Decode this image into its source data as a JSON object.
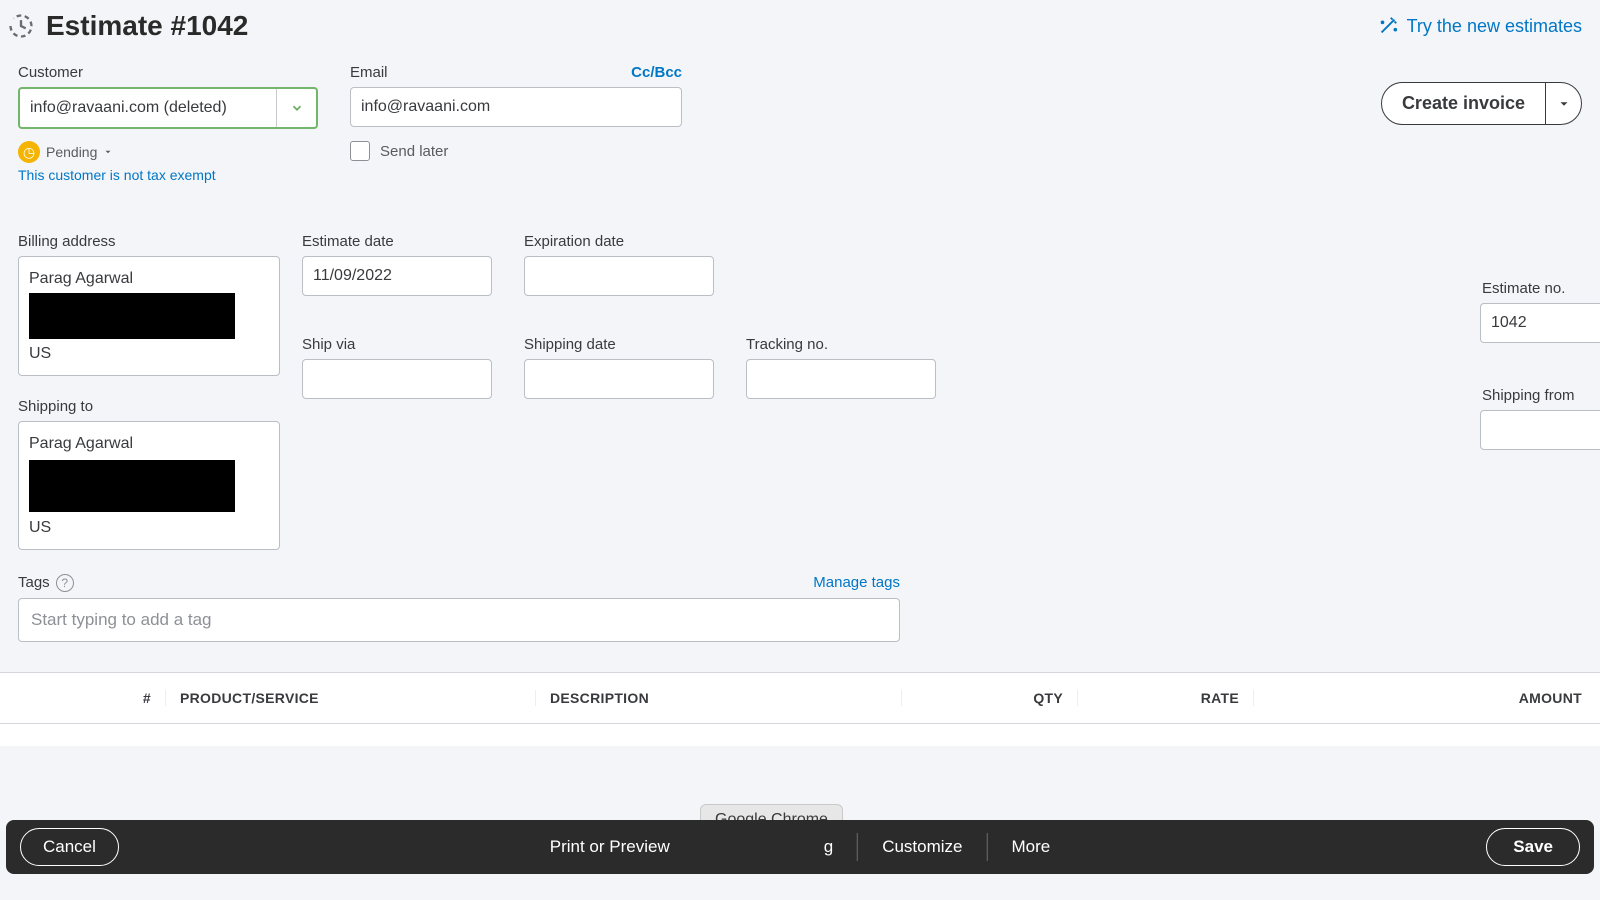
{
  "header": {
    "title": "Estimate #1042",
    "try_new": "Try the new estimates"
  },
  "customer": {
    "label": "Customer",
    "value": "info@ravaani.com (deleted)",
    "status": "Pending",
    "tax_note": "This customer is not tax exempt"
  },
  "email": {
    "label": "Email",
    "ccbcc": "Cc/Bcc",
    "value": "info@ravaani.com",
    "send_later": "Send later"
  },
  "buttons": {
    "create_invoice": "Create invoice",
    "cancel": "Cancel",
    "save": "Save"
  },
  "billing": {
    "label": "Billing address",
    "line1": "Parag Agarwal",
    "line_last": "US"
  },
  "shipping_to": {
    "label": "Shipping to",
    "line1": "Parag Agarwal",
    "line_last": "US"
  },
  "estimate_date": {
    "label": "Estimate date",
    "value": "11/09/2022"
  },
  "expiration_date": {
    "label": "Expiration date",
    "value": ""
  },
  "ship_via": {
    "label": "Ship via",
    "value": ""
  },
  "shipping_date": {
    "label": "Shipping date",
    "value": ""
  },
  "tracking_no": {
    "label": "Tracking no.",
    "value": ""
  },
  "estimate_no": {
    "label": "Estimate no.",
    "value": "1042"
  },
  "shipping_from": {
    "label": "Shipping from",
    "value": ""
  },
  "tags": {
    "label": "Tags",
    "manage": "Manage tags",
    "placeholder": "Start typing to add a tag"
  },
  "table": {
    "num": "#",
    "product": "PRODUCT/SERVICE",
    "description": "DESCRIPTION",
    "qty": "QTY",
    "rate": "RATE",
    "amount": "AMOUNT"
  },
  "footer": {
    "print": "Print or Preview",
    "customize": "Customize",
    "more": "More",
    "hidden_tail": "g"
  },
  "tooltip": "Google Chrome"
}
